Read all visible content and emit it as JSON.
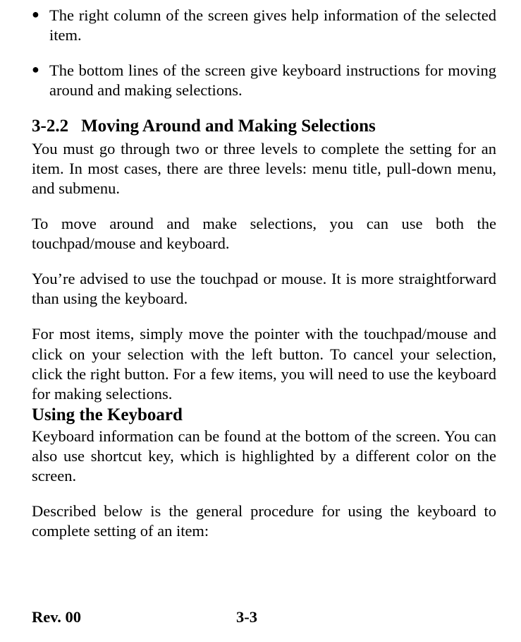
{
  "bullets": [
    "The right column of the screen gives help information of the selected item.",
    "The bottom lines of the screen give keyboard instructions for moving around and making selections."
  ],
  "section": {
    "number": "3-2.2",
    "title": "Moving Around and Making Selections"
  },
  "paragraphs": {
    "p1": "You must go through two or three levels to complete the setting for an item. In most cases, there are three levels: menu title, pull-down menu, and submenu.",
    "p2": "To move around and make selections, you can use both the touchpad/mouse and keyboard.",
    "p3": "You’re advised to use the touchpad or mouse. It is more straightforward than using the keyboard.",
    "p4": "For most items, simply move the pointer with the touchpad/mouse and click on your  selection with the left button. To cancel your selection, click the right button. For a few items, you will need to use the keyboard for making selections."
  },
  "subheading": "Using the Keyboard",
  "subparagraphs": {
    "p5": "Keyboard information can be found at the bottom of the screen. You can also use shortcut key, which is highlighted by a different color on the screen.",
    "p6": "Described below is the general procedure for using the keyboard to complete setting of an item:"
  },
  "footer": {
    "revision": "Rev. 00",
    "page": "3-3"
  }
}
